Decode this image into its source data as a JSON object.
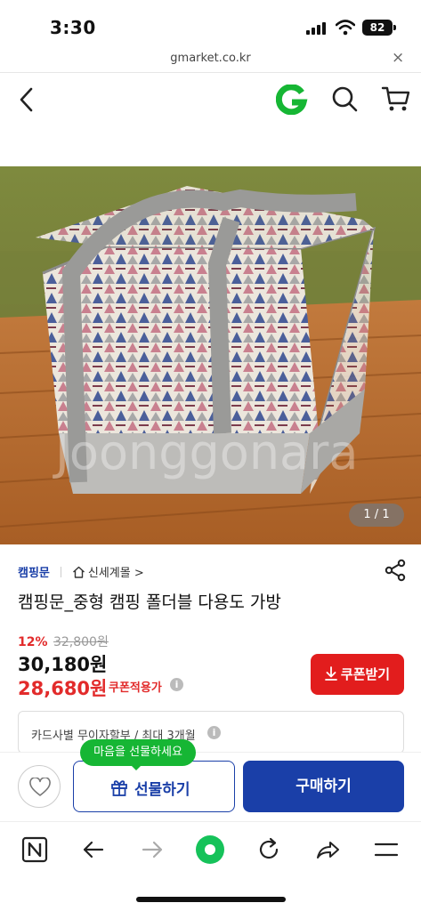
{
  "status_bar": {
    "time": "3:30",
    "battery": "82"
  },
  "browser": {
    "url": "gmarket.co.kr",
    "close_glyph": "×"
  },
  "header": {
    "logo_text": "G",
    "icons": [
      "back-icon",
      "search-icon",
      "cart-icon"
    ]
  },
  "image": {
    "counter": "1 / 1",
    "watermark": "Joonggonara"
  },
  "product": {
    "brand": "캠핑문",
    "store": "신세계몰",
    "store_chevron": ">",
    "title": "캠핑문_중형 캠핑 폴더블 다용도 가방",
    "discount_rate": "12%",
    "original_price": "32,800원",
    "price": "30,180원",
    "coupon_price": "28,680원",
    "coupon_label": "쿠폰적용가",
    "coupon_button": "쿠폰받기",
    "card_info": "카드사별 무이자할부 / 최대 3개월",
    "info_glyph": "i"
  },
  "actions": {
    "tooltip": "마음을 선물하세요",
    "gift_button": "선물하기",
    "buy_button": "구매하기"
  },
  "colors": {
    "brand_blue": "#1a3fa8",
    "sale_red": "#e22b2b",
    "gmarket_green": "#16b634"
  }
}
